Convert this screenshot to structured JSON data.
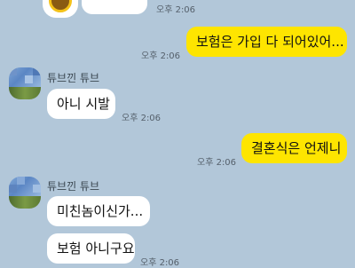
{
  "conversation": {
    "messages": [
      {
        "id": "m0",
        "side": "left",
        "text": "",
        "time": "오후 2:06"
      },
      {
        "id": "m1",
        "side": "right",
        "text": "보험은 가입 다 되어있어...",
        "time": "오후 2:06"
      },
      {
        "id": "m2",
        "side": "left",
        "sender": "튜브낀 튜브",
        "text": "아니 시발",
        "time": "오후 2:06"
      },
      {
        "id": "m3",
        "side": "right",
        "text": "결혼식은 언제니",
        "time": "오후 2:06"
      },
      {
        "id": "m4",
        "side": "left",
        "sender": "튜브낀 튜브",
        "text": "미친놈이신가...",
        "time": ""
      },
      {
        "id": "m5",
        "side": "left",
        "text": "보험 아니구요",
        "time": "오후 2:06"
      }
    ]
  },
  "colors": {
    "background": "#b2c7d9",
    "my_bubble": "#fee500",
    "their_bubble": "#ffffff"
  }
}
